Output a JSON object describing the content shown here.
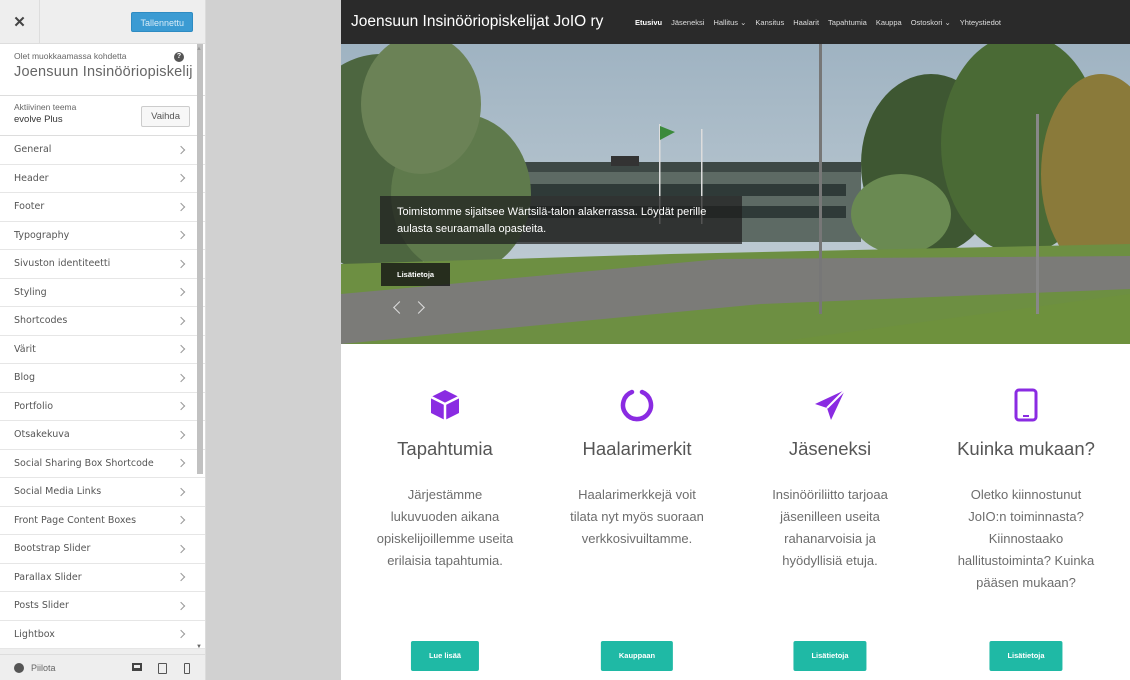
{
  "customizer": {
    "close_icon": "close-icon",
    "saved_label": "Tallennettu",
    "editing_label": "Olet muokkaamassa kohdetta",
    "editing_title": "Joensuun Insinööriopiskelij...",
    "help_icon": "?",
    "theme_label": "Aktiivinen teema",
    "theme_name": "evolve Plus",
    "change_label": "Vaihda",
    "sections": [
      "General",
      "Header",
      "Footer",
      "Typography",
      "Sivuston identiteetti",
      "Styling",
      "Shortcodes",
      "Värit",
      "Blog",
      "Portfolio",
      "Otsakekuva",
      "Social Sharing Box Shortcode",
      "Social Media Links",
      "Front Page Content Boxes",
      "Bootstrap Slider",
      "Parallax Slider",
      "Posts Slider",
      "Lightbox"
    ],
    "footer": {
      "hide_label": "Piilota",
      "devices": [
        "desktop-icon",
        "tablet-icon",
        "mobile-icon"
      ]
    }
  },
  "site": {
    "title": "Joensuun Insinööriopiskelijat JoIO ry",
    "menu": [
      "Etusivu",
      "Jäseneksi",
      "Hallitus ⌄",
      "Kansitus",
      "Haalarit",
      "Tapahtumia",
      "Kauppa",
      "Ostoskori ⌄",
      "Yhteystiedot"
    ],
    "active_menu": "Etusivu",
    "slider": {
      "caption": "Toimistomme sijaitsee Wärtsilä-talon alakerrassa. Löydät perille aulasta seuraamalla opasteita.",
      "button": "Lisätietoja"
    },
    "boxes": [
      {
        "icon": "cube-icon",
        "title": "Tapahtumia",
        "text": "Järjestämme lukuvuoden aikana opiskelijoillemme useita erilaisia tapahtumia.",
        "button": "Lue lisää"
      },
      {
        "icon": "ring-icon",
        "title": "Haalarimerkit",
        "text": "Haalarimerkkejä voit tilata nyt myös suoraan verkkosivuiltamme.",
        "button": "Kauppaan"
      },
      {
        "icon": "paper-plane-icon",
        "title": "Jäseneksi",
        "text": "Insinööriliitto tarjoaa jäsenilleen useita rahanarvoisia ja hyödyllisiä etuja.",
        "button": "Lisätietoja"
      },
      {
        "icon": "tablet-icon",
        "title": "Kuinka mukaan?",
        "text": "Oletko kiinnostunut JoIO:n toiminnasta? Kiinnostaako hallitustoiminta? Kuinka pääsen mukaan?",
        "button": "Lisätietoja"
      }
    ],
    "colors": {
      "accent": "#1fb9a5",
      "icon": "#8a2be2",
      "nav": "#2a2a2a"
    }
  }
}
